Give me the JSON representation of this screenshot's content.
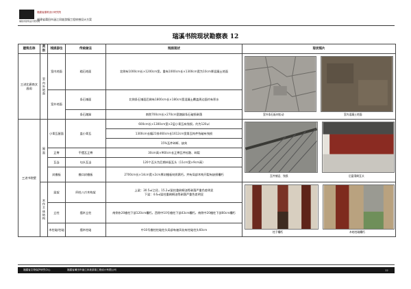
{
  "header": {
    "logo_caption": "福建省建筑设计研究院",
    "top_line": "福建省建筑设计研究院",
    "subtitle": "福建省莆田市涵江凤坡游镇工程修缮设计方案"
  },
  "title": "瑞溪书院现状勘察表 12",
  "columns": [
    "建筑名称",
    "类别",
    "残损部位",
    "传统做法",
    "残损现状",
    "现状照片"
  ],
  "sections": {
    "first_building": "三进北廊南文昌阁",
    "first_category": "室内外地面",
    "second_building": "三进书院壁",
    "roof_category": "屋面",
    "wood_category": "木作主体结构"
  },
  "rows": {
    "r1": {
      "part": "室内地面",
      "method": "糙石地面",
      "status": "北侧有1000cm长×1200cm宽，重有1000cm长×1300cm宽为10cm厚混凝土地面"
    },
    "r2": {
      "part": "室外地面",
      "method": "条石铺面",
      "status": "北侧条石铺面后刷有1800cm长×180cm宽混凝土覆盖周边面约有积水"
    },
    "r3": {
      "method": "条石踏跺",
      "status": "南院700cm长×270cm宽踏跺条石破损剥落"
    },
    "r4": {
      "sub": "小青瓦屋面",
      "method": "盖小青瓦",
      "status": "600cm长×1300cm宽×2层小青瓦有残损，约为120㎡"
    },
    "r5": {
      "status": "1300cm长编21排460cm长1612cm宽青瓦构件残破有残损"
    },
    "r6": {
      "status": "15%瓦件碎断、缺失"
    },
    "r7": {
      "part": "正脊",
      "method": "干摆瓦正脊",
      "status": "30cm高×960cm长正脊瓦件松散、碎裂"
    },
    "r8": {
      "part": "瓦当",
      "method": "勾头瓦当",
      "status": "120个瓦头为后期补配瓦头（11cm宽×9cm高）"
    },
    "r9": {
      "part": "封檐板",
      "method": "檐口封檐板",
      "status": "2700cm长×14cm宽×2cm厚封檐板材质腐朽，并有局部木构开裂有缺损糟朽"
    },
    "r10": {
      "part": "梁架",
      "method": "四柱八爪木构架",
      "status": "上梁：30.5㎡之径，15.2㎡梁柱重刷桐油等剥落严重色差明显\n下梁：4.6㎡梁柱重刷桐油等剥落严重色差明显"
    },
    "r11": {
      "part": "立柱",
      "method": "擂木立柱",
      "status": "南侧东20檐柱下部120cm糟朽，西侧中10号檐柱下部43cm糟朽，南侧中20檐柱下部60cm糟朽"
    },
    "r12": {
      "sub": "木柱础/柱础",
      "part": "柱础",
      "method": "擂木柱础",
      "status": "中10号檐柱柱础柱头局部有被风化有柱础柱头60cm"
    }
  },
  "captions": {
    "c1": "室外条石板材松动",
    "c2": "室内混凝土地面",
    "c3": "瓦件铺设、残损",
    "c4": "后窗滑刷瓦头",
    "c5": "柱子糟朽",
    "c6": "木结柱础糟朽"
  },
  "footer": {
    "left": "福建省文物保护研究中心",
    "right": "福建省莆田市涵江凤坡游镇工程设计有限公司",
    "page": "12"
  }
}
